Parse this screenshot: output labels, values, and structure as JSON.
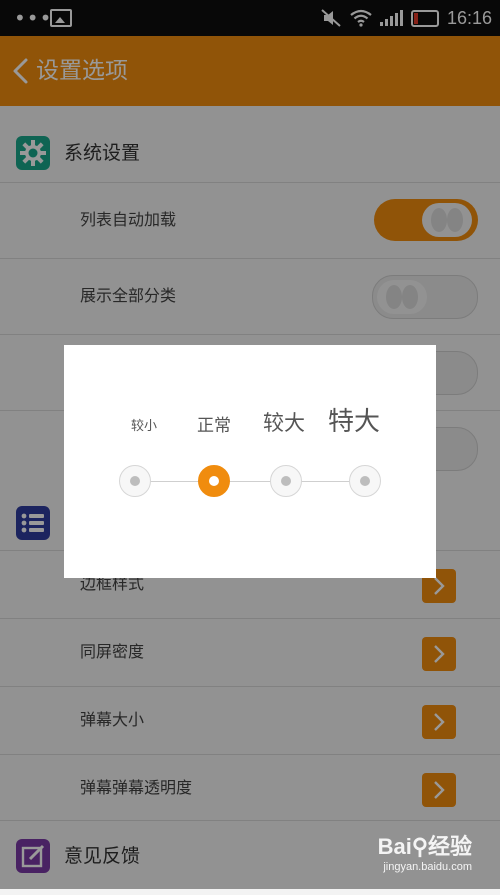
{
  "status_bar": {
    "time": "16:16",
    "dots": "•••"
  },
  "app_bar": {
    "title": "设置选项"
  },
  "sections": [
    {
      "label": "系统设置",
      "icon": "gear-icon",
      "color": "#1aa78b"
    },
    {
      "label": "",
      "icon": "list-icon",
      "color": "#2f3c9e"
    },
    {
      "label": "意见反馈",
      "icon": "edit-icon",
      "color": "#7b3aa5"
    }
  ],
  "system_rows": [
    {
      "label": "列表自动加载",
      "toggle_on": true
    },
    {
      "label": "展示全部分类",
      "toggle_on": false
    }
  ],
  "danmaku_rows": [
    {
      "label": "边框样式"
    },
    {
      "label": "同屏密度"
    },
    {
      "label": "弹幕大小"
    },
    {
      "label": "弹幕弹幕透明度"
    }
  ],
  "dialog": {
    "options": [
      "较小",
      "正常",
      "较大",
      "特大"
    ],
    "selected_index": 1
  },
  "watermark": {
    "brand": "Bai⚲经验",
    "url": "jingyan.baidu.com"
  },
  "colors": {
    "accent": "#f08c0e",
    "status_bar": "#0e0e0e"
  }
}
